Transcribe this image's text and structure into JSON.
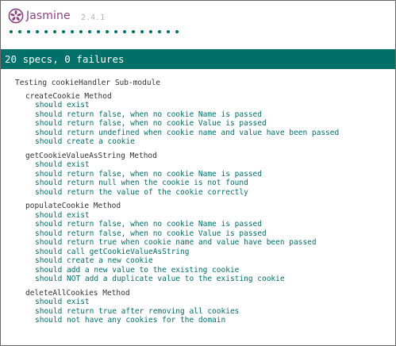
{
  "header": {
    "app_name": "Jasmine",
    "version": "2.4.1",
    "dot_count": 20,
    "accent_color": "#007069",
    "logo_color": "#8a4182"
  },
  "summary": {
    "text": "20 specs, 0 failures"
  },
  "suite": {
    "title": "Testing cookieHandler Sub-module",
    "children": [
      {
        "title": "createCookie Method",
        "specs": [
          "should exist",
          "should return false, when no cookie Name is passed",
          "should return false, when no cookie Value is passed",
          "should return undefined when cookie name and value have been passed",
          "should create a cookie"
        ]
      },
      {
        "title": "getCookieValueAsString Method",
        "specs": [
          "should exist",
          "should return false, when no cookie Name is passed",
          "should return null when the cookie is not found",
          "should return the value of the cookie correctly"
        ]
      },
      {
        "title": "populateCookie Method",
        "specs": [
          "should exist",
          "should return false, when no cookie Name is passed",
          "should return false, when no cookie Value is passed",
          "should return true when cookie name and value have been passed",
          "should call getCookieValueAsString",
          "should create a new cookie",
          "should add a new value to the existing cookie",
          "should NOT add a duplicate value to the existing cookie"
        ]
      },
      {
        "title": "deleteAllCookies Method",
        "specs": [
          "should exist",
          "should return true after removing all cookies",
          "should not have any cookies for the domain"
        ]
      }
    ]
  }
}
